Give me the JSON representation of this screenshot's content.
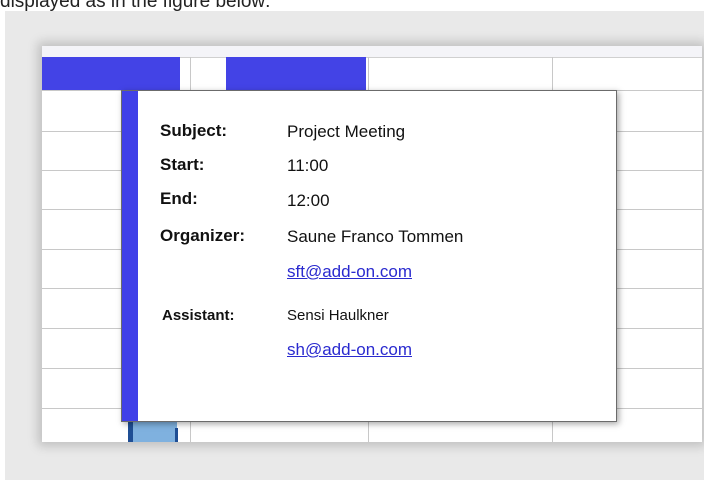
{
  "caption": "displayed as in the figure below:",
  "appointment": {
    "subject_label": "Subject:",
    "subject": "Project Meeting",
    "start_label": "Start:",
    "start": "11:00",
    "end_label": "End:",
    "end": "12:00",
    "organizer_label": "Organizer:",
    "organizer_name": "Saune Franco Tommen",
    "organizer_email": "sft@add-on.com",
    "assistant_label": "Assistant:",
    "assistant_name": "Sensi Haulkner",
    "assistant_email": "sh@add-on.com"
  },
  "colors": {
    "accent": "#4040e8",
    "column_band": "#7fb1df",
    "column_stripe": "#1f4e94",
    "link": "#2a2acf",
    "backdrop": "#e9e9e9"
  }
}
